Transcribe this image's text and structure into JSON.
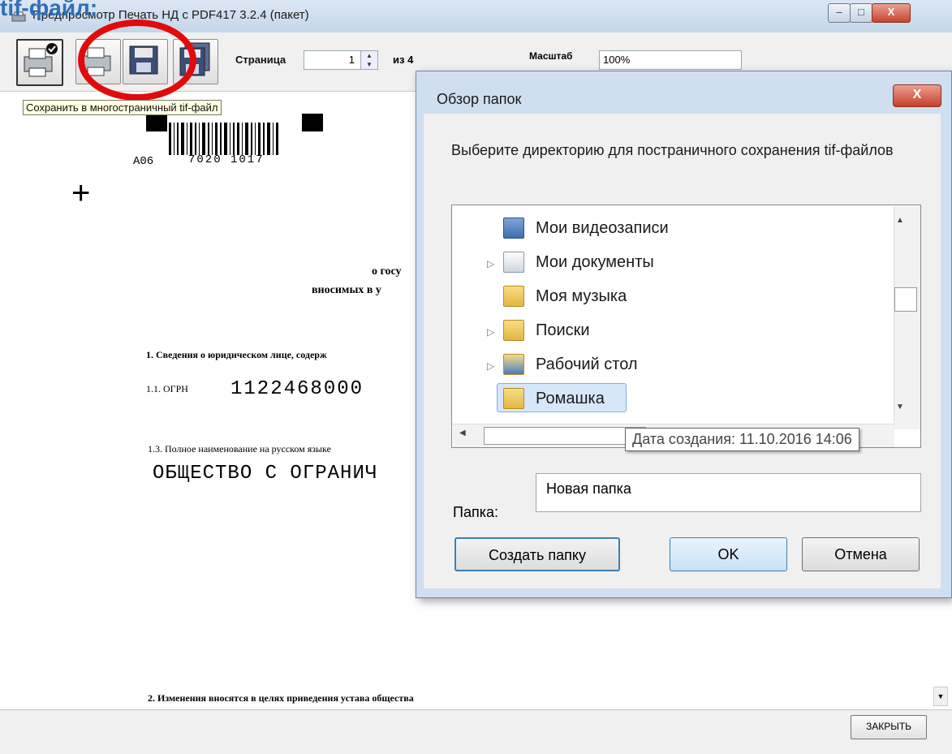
{
  "overlay_heading": "tif-файл:",
  "window": {
    "title": "Предпросмотр Печать НД с PDF417 3.2.4 (пакет)",
    "min_label": "–",
    "max_label": "□",
    "close_label": "X"
  },
  "toolbar": {
    "page_label": "Страница",
    "page_value": "1",
    "of_label": "из 4",
    "scale_label": "Масштаб",
    "scale_value": "100%",
    "save_tooltip": "Сохранить в многостраничный tif-файл"
  },
  "document": {
    "barcode_left": "A06",
    "barcode_number": "7020 1017",
    "line1": "о госу",
    "line2": "вносимых в у",
    "section1": "1.   Сведения о юридическом лице, содерж",
    "ogrn_label": "1.1. ОГРН",
    "ogrn_value": "1122468000",
    "item13": "1.3. Полное наименование на русском языке",
    "company_name": "ОБЩЕСТВО С ОГРАНИЧ",
    "section2": "2.   Изменения вносятся в целях приведения устава общества"
  },
  "bottom": {
    "close_label": "ЗАКРЫТЬ"
  },
  "dialog": {
    "title": "Обзор папок",
    "close_label": "X",
    "description": "Выберите директорию для постраничного сохранения tif-файлов",
    "tree": [
      {
        "label": "Мои видеозаписи",
        "expandable": false,
        "icon": "video-folder-icon"
      },
      {
        "label": "Мои документы",
        "expandable": true,
        "icon": "documents-folder-icon"
      },
      {
        "label": "Моя музыка",
        "expandable": false,
        "icon": "music-folder-icon"
      },
      {
        "label": "Поиски",
        "expandable": true,
        "icon": "search-folder-icon"
      },
      {
        "label": "Рабочий стол",
        "expandable": true,
        "icon": "desktop-folder-icon"
      },
      {
        "label": "Ромашка",
        "expandable": false,
        "icon": "folder-icon",
        "selected": true
      }
    ],
    "date_tooltip": "Дата создания: 11.10.2016 14:06",
    "folder_label": "Папка:",
    "folder_value": "Новая папка",
    "create_button": "Создать папку",
    "ok_button": "OK",
    "cancel_button": "Отмена"
  },
  "colors": {
    "highlight_circle": "#e10b0b",
    "heading": "#2f6fb8"
  }
}
